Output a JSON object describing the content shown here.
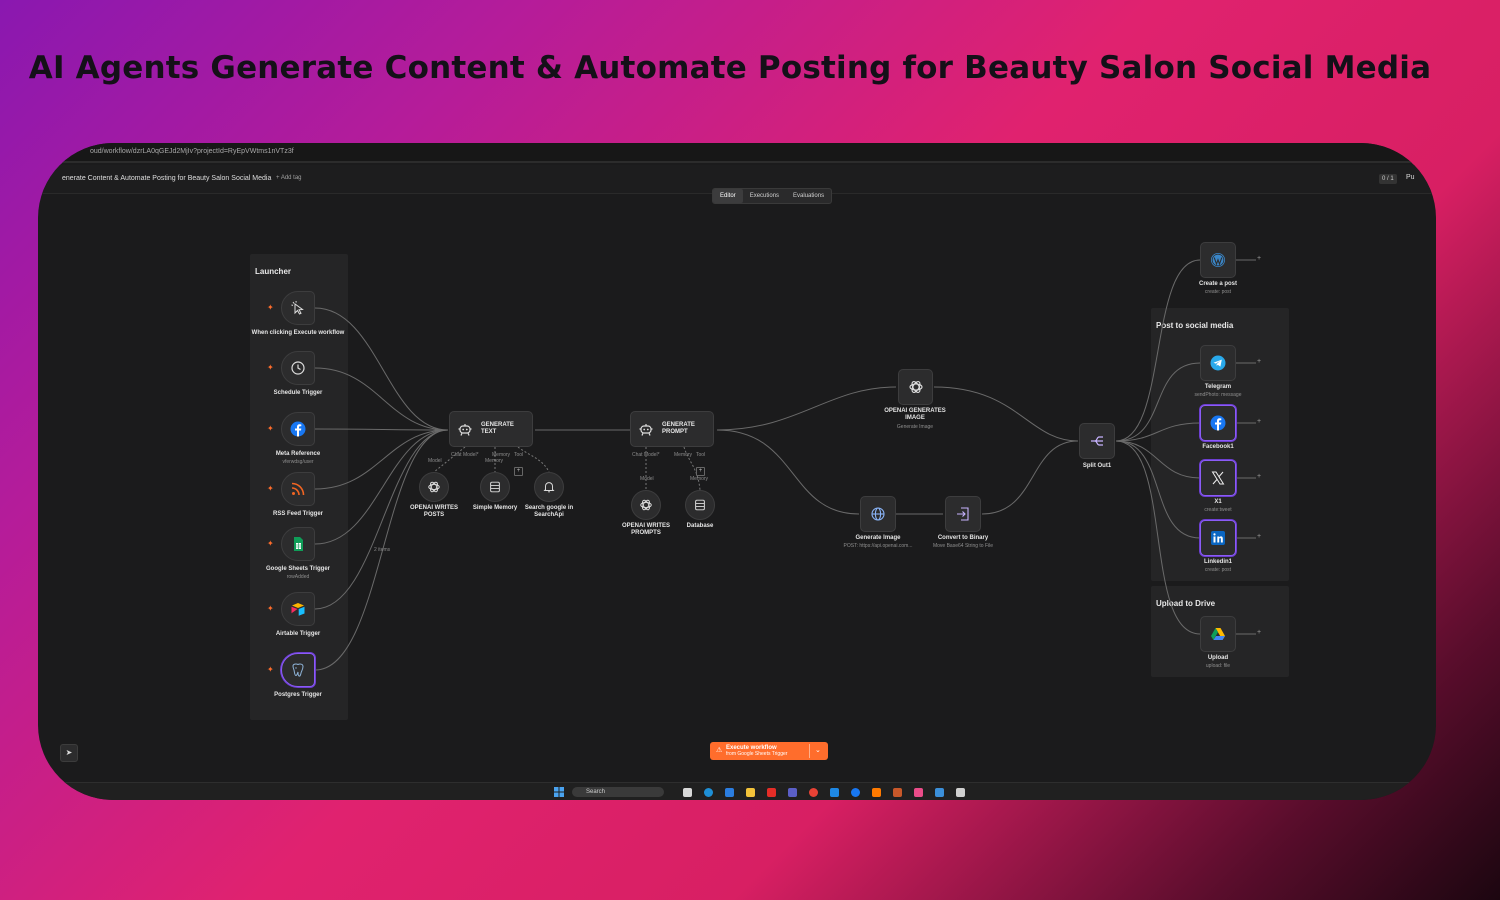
{
  "headline": "AI Agents Generate Content & Automate Posting for Beauty Salon Social Media",
  "browser": {
    "url": "oud/workflow/dzrLA0qGEJd2MjIv?projectId=RyEpVWtms1nVTz3f"
  },
  "app": {
    "workflow_title": "enerate Content & Automate Posting for Beauty Salon Social Media",
    "add_tag": "+ Add tag",
    "counter": "0 / 1",
    "publish_partial": "Pu"
  },
  "tabs": [
    {
      "label": "Editor",
      "active": true
    },
    {
      "label": "Executions",
      "active": false
    },
    {
      "label": "Evaluations",
      "active": false
    }
  ],
  "groups": {
    "launcher": "Launcher",
    "post_social": "Post to social media",
    "upload_drive": "Upload to Drive"
  },
  "triggers": [
    {
      "label": "When clicking Execute workflow",
      "sub": "",
      "icon": "cursor-click-icon"
    },
    {
      "label": "Schedule Trigger",
      "sub": "",
      "icon": "clock-icon"
    },
    {
      "label": "Meta Reference",
      "sub": "vferwdsg/user",
      "icon": "facebook-icon"
    },
    {
      "label": "RSS Feed Trigger",
      "sub": "",
      "icon": "rss-icon"
    },
    {
      "label": "Google Sheets Trigger",
      "sub": "rowAdded",
      "icon": "google-sheets-icon"
    },
    {
      "label": "Airtable Trigger",
      "sub": "",
      "icon": "airtable-icon"
    },
    {
      "label": "Postgres Trigger",
      "sub": "",
      "icon": "postgres-icon"
    }
  ],
  "agents": {
    "generate_text": {
      "title": "GENERATE\nTEXT",
      "ports": [
        "Chat Model*",
        "Memory",
        "Tool"
      ]
    },
    "generate_prompt": {
      "title": "GENERATE\nPROMPT",
      "ports": [
        "Chat Model*",
        "Memory",
        "Tool"
      ]
    }
  },
  "sub_nodes": {
    "openai_posts": {
      "label": "OPENAI WRITES\nPOSTS",
      "port": "Model"
    },
    "simple_memory": {
      "label": "Simple Memory",
      "port": "Memory"
    },
    "search_google": {
      "label": "Search google in\nSearchApi"
    },
    "openai_prompts": {
      "label": "OPENAI WRITES\nPROMPTS",
      "port": "Model"
    },
    "database": {
      "label": "Database",
      "port": "Memory"
    }
  },
  "nodes": {
    "openai_image": {
      "label": "OPENAI GENERATES\nIMAGE",
      "sub": "Generate Image"
    },
    "generate_image": {
      "label": "Generate Image",
      "sub": "POST: https://api.openai.com..."
    },
    "convert_binary": {
      "label": "Convert to Binary",
      "sub": "Move Base64 String to File"
    },
    "split_out": {
      "label": "Split Out1",
      "sub": ""
    },
    "wordpress": {
      "label": "Create a post",
      "sub": "create: post"
    },
    "telegram": {
      "label": "Telegram",
      "sub": "sendPhoto: message"
    },
    "facebook": {
      "label": "Facebook1",
      "sub": ""
    },
    "x": {
      "label": "X1",
      "sub": "create:tweet"
    },
    "linkedin": {
      "label": "Linkedin1",
      "sub": "create: post"
    },
    "drive": {
      "label": "Upload",
      "sub": "upload: file"
    }
  },
  "edge_label": "2 items",
  "execute": {
    "label": "Execute workflow",
    "sub": "from Google Sheets Trigger"
  },
  "taskbar": {
    "search": "Search"
  },
  "colors": {
    "accent": "#ff6d2c",
    "selected": "#8b5cf6",
    "canvas": "#1b1b1c"
  }
}
